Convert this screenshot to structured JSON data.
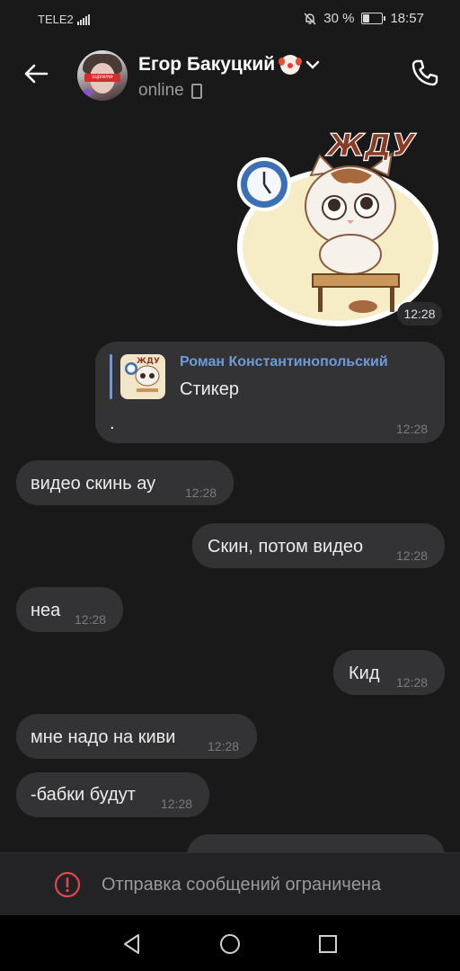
{
  "status_bar": {
    "carrier": "TELE2",
    "battery_percent": "30 %",
    "battery_level": 0.3,
    "time": "18:57"
  },
  "header": {
    "contact_name": "Егор Бакуцкий",
    "status": "online",
    "icons": [
      "back-arrow-icon",
      "clown-emoji-icon",
      "chevron-down-icon",
      "mobile-device-icon",
      "phone-icon"
    ]
  },
  "messages": [
    {
      "type": "sticker",
      "direction": "out",
      "caption": "ЖДУ",
      "time": "12:28"
    },
    {
      "type": "reply",
      "direction": "out",
      "reply_author": "Роман Константинопольский",
      "reply_text": "Стикер",
      "text": ".",
      "time": "12:28"
    },
    {
      "type": "text",
      "direction": "in",
      "text": "видео скинь ау",
      "time": "12:28"
    },
    {
      "type": "text",
      "direction": "out",
      "text": "Скин, потом видео",
      "time": "12:28"
    },
    {
      "type": "text",
      "direction": "in",
      "text": "неа",
      "time": "12:28"
    },
    {
      "type": "text",
      "direction": "out",
      "text": "Кид",
      "time": "12:28"
    },
    {
      "type": "text",
      "direction": "in",
      "text": "мне надо на киви",
      "time": "12:28"
    },
    {
      "type": "text",
      "direction": "in",
      "text": "-бабки будут",
      "time": "12:28"
    }
  ],
  "composer": {
    "notice": "Отправка сообщений ограничена"
  },
  "colors": {
    "background": "#19191a",
    "bubble": "#333335",
    "accent": "#6d9bd8",
    "alert": "#e0464e"
  }
}
